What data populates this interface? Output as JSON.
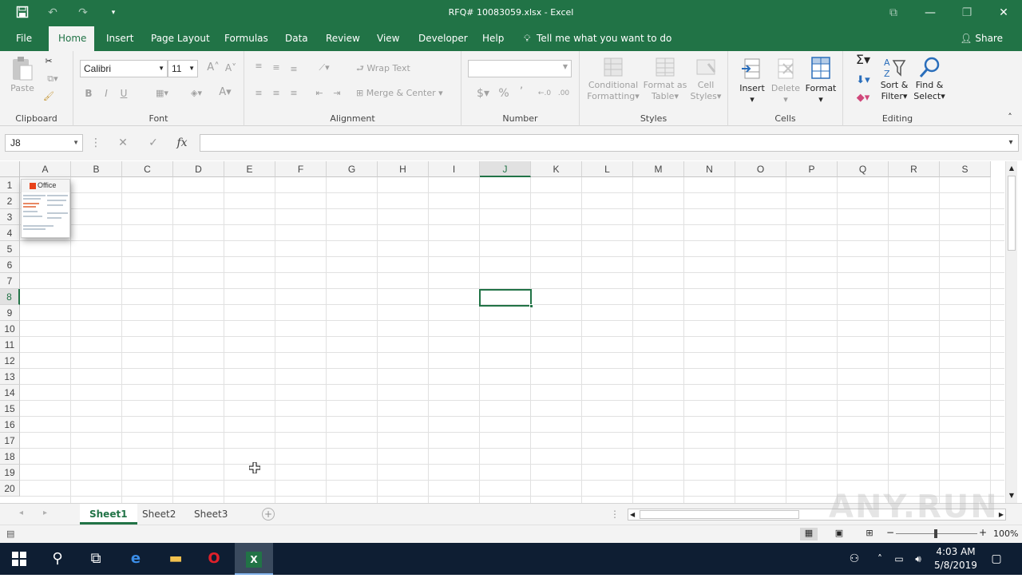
{
  "window": {
    "title": "RFQ# 10083059.xlsx  -  Excel",
    "qat": [
      "save-icon",
      "undo-icon",
      "redo-icon",
      "customize-qat-icon"
    ],
    "controls": [
      "ribbon-display-icon",
      "minimize-icon",
      "restore-icon",
      "close-icon"
    ]
  },
  "tabs": [
    "File",
    "Home",
    "Insert",
    "Page Layout",
    "Formulas",
    "Data",
    "Review",
    "View",
    "Developer",
    "Help"
  ],
  "active_tab": "Home",
  "tell_me": "Tell me what you want to do",
  "share": "Share",
  "ribbon": {
    "clipboard": {
      "label": "Clipboard",
      "paste": "Paste"
    },
    "font": {
      "label": "Font",
      "name": "Calibri",
      "size": "11",
      "bold": "B",
      "italic": "I",
      "underline": "U"
    },
    "alignment": {
      "label": "Alignment",
      "wrap": "Wrap Text",
      "merge": "Merge & Center"
    },
    "number": {
      "label": "Number",
      "format": "",
      "currency": "$",
      "percent": "%",
      "comma": "’"
    },
    "styles": {
      "label": "Styles",
      "conditional": [
        "Conditional",
        "Formatting"
      ],
      "format_table": [
        "Format as",
        "Table"
      ],
      "cell_styles": [
        "Cell",
        "Styles"
      ]
    },
    "cells": {
      "label": "Cells",
      "insert": "Insert",
      "delete": "Delete",
      "format": "Format"
    },
    "editing": {
      "label": "Editing",
      "sort": [
        "Sort &",
        "Filter"
      ],
      "find": [
        "Find &",
        "Select"
      ]
    }
  },
  "formula_bar": {
    "name_box": "J8",
    "cancel": "✕",
    "enter": "✓",
    "fx": "fx",
    "content": ""
  },
  "columns": [
    "A",
    "B",
    "C",
    "D",
    "E",
    "F",
    "G",
    "H",
    "I",
    "J",
    "K",
    "L",
    "M",
    "N",
    "O",
    "P",
    "Q",
    "R",
    "S"
  ],
  "rows": [
    "1",
    "2",
    "3",
    "4",
    "5",
    "6",
    "7",
    "8",
    "9",
    "10",
    "11",
    "12",
    "13",
    "14",
    "15",
    "16",
    "17",
    "18",
    "19",
    "20"
  ],
  "selected_cell": {
    "column": "J",
    "row": "8"
  },
  "embedded_image": {
    "logo_text": "Office"
  },
  "sheets": [
    "Sheet1",
    "Sheet2",
    "Sheet3"
  ],
  "active_sheet": "Sheet1",
  "status": {
    "zoom": "100%",
    "zoom_out": "−",
    "zoom_in": "+"
  },
  "taskbar": {
    "apps": [
      "start-icon",
      "search-icon",
      "task-view-icon",
      "edge-icon",
      "file-explorer-icon",
      "opera-icon",
      "excel-icon"
    ],
    "time": "4:03 AM",
    "date": "5/8/2019"
  },
  "watermark": "ANY.RUN",
  "colors": {
    "accent": "#217346",
    "taskbar": "#0e1e33",
    "ribbon": "#f3f3f3"
  }
}
